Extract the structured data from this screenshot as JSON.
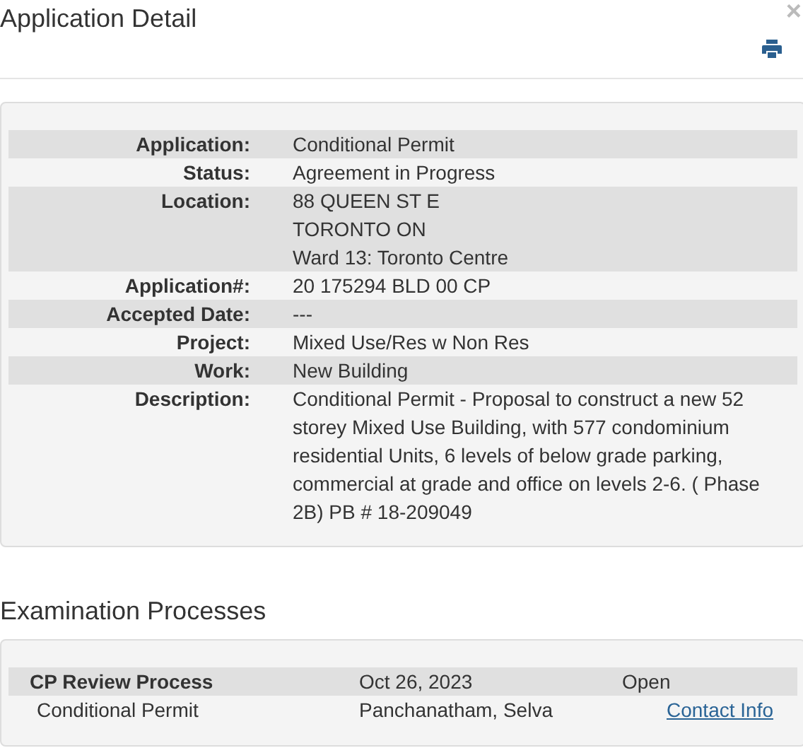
{
  "title": "Application Detail",
  "close": "×",
  "details": [
    {
      "label": "Application:",
      "lines": [
        "Conditional Permit"
      ]
    },
    {
      "label": "Status:",
      "lines": [
        "Agreement in Progress"
      ]
    },
    {
      "label": "Location:",
      "lines": [
        "88 QUEEN ST E",
        "TORONTO ON",
        "Ward 13: Toronto Centre"
      ]
    },
    {
      "label": "Application#:",
      "lines": [
        "20 175294 BLD 00 CP"
      ]
    },
    {
      "label": "Accepted Date:",
      "lines": [
        "---"
      ]
    },
    {
      "label": "Project:",
      "lines": [
        "Mixed Use/Res w Non Res"
      ]
    },
    {
      "label": "Work:",
      "lines": [
        "New Building"
      ]
    },
    {
      "label": "Description:",
      "lines": [
        "Conditional Permit - Proposal to construct a new 52 storey Mixed Use Building, with 577 condominium residential Units, 6 levels of below grade parking, commercial at grade and office on levels 2-6. ( Phase 2B) PB # 18-209049"
      ]
    }
  ],
  "examination": {
    "heading": "Examination Processes",
    "process": {
      "name": "CP Review Process",
      "date": "Oct 26, 2023",
      "status": "Open"
    },
    "step": {
      "name": "Conditional Permit",
      "examiner": "Panchanatham, Selva",
      "link": "Contact Info"
    }
  }
}
